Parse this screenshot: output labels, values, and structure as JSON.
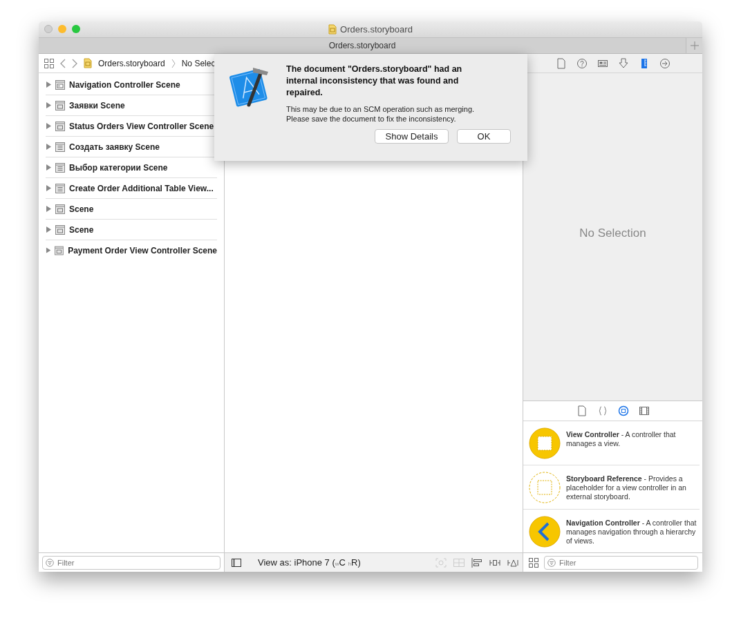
{
  "window": {
    "title": "Orders.storyboard"
  },
  "tab_bar": {
    "tabs": [
      {
        "label": "Orders.storyboard",
        "selected": true
      }
    ]
  },
  "jump_bar": {
    "items": [
      "Orders.storyboard",
      "No Selec"
    ]
  },
  "outline": {
    "items": [
      {
        "label": "Navigation Controller Scene",
        "kind": "navigation",
        "expanded": false
      },
      {
        "label": "Заявки Scene",
        "kind": "scene",
        "expanded": false
      },
      {
        "label": "Status Orders View Controller Scene",
        "kind": "scene",
        "expanded": false
      },
      {
        "label": "Создать заявку Scene",
        "kind": "table",
        "expanded": false
      },
      {
        "label": "Выбор категории Scene",
        "kind": "table",
        "expanded": false
      },
      {
        "label": "Create Order Additional Table View...",
        "kind": "table",
        "expanded": false
      },
      {
        "label": "Scene",
        "kind": "scene",
        "expanded": false
      },
      {
        "label": "Scene",
        "kind": "scene",
        "expanded": false
      },
      {
        "label": "Payment Order View Controller Scene",
        "kind": "scene",
        "expanded": false
      }
    ],
    "filter": {
      "placeholder": "Filter"
    }
  },
  "dialog": {
    "title": "The document \"Orders.storyboard\" had an internal inconsistency that was found and repaired.",
    "message": "This may be due to an SCM operation such as merging. Please save the document to fix the inconsistency.",
    "buttons": [
      {
        "label": "Show Details",
        "default": false
      },
      {
        "label": "OK",
        "default": false
      }
    ]
  },
  "canvas_bar": {
    "view_as": "View as: iPhone 7 ($_{w}$C $_{h}$R)"
  },
  "inspector": {
    "tabs": [
      {
        "kind": "file",
        "selected": false
      },
      {
        "kind": "help",
        "selected": false
      },
      {
        "kind": "identity",
        "selected": false
      },
      {
        "kind": "attributes",
        "selected": false
      },
      {
        "kind": "size",
        "selected": true
      },
      {
        "kind": "connections",
        "selected": false
      }
    ],
    "empty_text": "No Selection"
  },
  "library": {
    "tabs": [
      {
        "kind": "file",
        "selected": false
      },
      {
        "kind": "code",
        "selected": false
      },
      {
        "kind": "object",
        "selected": true
      },
      {
        "kind": "media",
        "selected": false
      }
    ],
    "items": [
      {
        "kind": "view-controller",
        "text": "**View Controller** - A controller that manages a view."
      },
      {
        "kind": "storyboard-reference",
        "text": "**Storyboard Reference** - Provides a placeholder for a view controller in an external storyboard."
      },
      {
        "kind": "navigation-controller",
        "text": "**Navigation Controller** - A controller that manages navigation through a hierarchy of views."
      }
    ],
    "filter": {
      "placeholder": "Filter"
    }
  }
}
